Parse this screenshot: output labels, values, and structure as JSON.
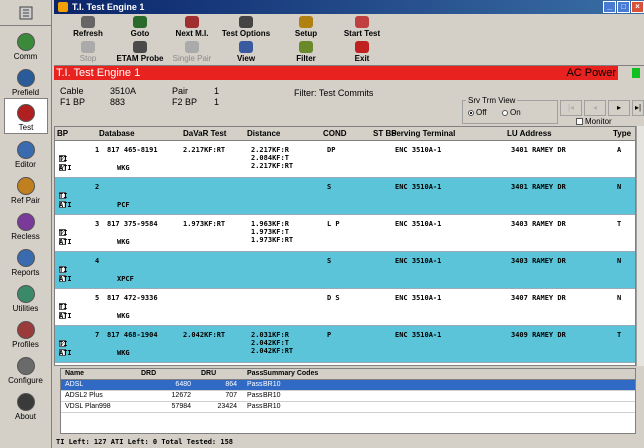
{
  "window": {
    "title": "T.I. Test Engine 1"
  },
  "sidebar": [
    {
      "label": "Comm",
      "icon": "comm-icon"
    },
    {
      "label": "Prefield",
      "icon": "prefield-icon"
    },
    {
      "label": "Test",
      "icon": "test-icon"
    },
    {
      "label": "Editor",
      "icon": "editor-icon"
    },
    {
      "label": "Ref Pair",
      "icon": "ref-pair-icon"
    },
    {
      "label": "Recless",
      "icon": "recless-icon"
    },
    {
      "label": "Reports",
      "icon": "reports-icon"
    },
    {
      "label": "Utilities",
      "icon": "utilities-icon"
    },
    {
      "label": "Profiles",
      "icon": "profiles-icon"
    },
    {
      "label": "Configure",
      "icon": "configure-icon"
    },
    {
      "label": "About",
      "icon": "about-icon"
    }
  ],
  "toolbar": {
    "row1": [
      "Refresh",
      "Goto",
      "Next M.I.",
      "Test Options",
      "Setup",
      "Start Test"
    ],
    "row2": [
      "Stop",
      "ETAM Probe",
      "Single Pair",
      "View",
      "Filter",
      "Exit"
    ]
  },
  "status_bar": {
    "title": "T.I. Test Engine 1",
    "power": "AC Power"
  },
  "info": {
    "cable_label": "Cable",
    "cable_value": "3510A",
    "pair_label": "Pair",
    "pair_value": "1",
    "f1bp_label": "F1 BP",
    "f1bp_value": "883",
    "f2bp_label": "F2 BP",
    "f2bp_value": "1",
    "filter": "Filter: Test Commits",
    "srv_title": "Srv Trm View",
    "off": "Off",
    "on": "On",
    "monitor": "Monitor"
  },
  "grid": {
    "headers": [
      "BP",
      "Database",
      "DaVaR Test",
      "Distance",
      "COND",
      "ST BP",
      "Serving Terminal",
      "LU Address",
      "Type"
    ],
    "rows": [
      {
        "num": "1",
        "db": "817 465-8191",
        "davar": "2.217KF:RT",
        "dist": [
          "2.217KF:R",
          "2.084KF:T",
          "2.217KF:RT"
        ],
        "cond": "DP",
        "term": "ENC 3510A-1",
        "addr": "3401 RAMEY DR",
        "type": "A",
        "ti": true,
        "ati": true,
        "sub": "WKG",
        "color": "w"
      },
      {
        "num": "2",
        "db": "",
        "davar": "",
        "dist": [],
        "cond": "S",
        "term": "ENC 3510A-1",
        "addr": "3401 RAMEY DR",
        "type": "N",
        "ti": false,
        "ati": false,
        "sub": "PCF",
        "color": "c"
      },
      {
        "num": "3",
        "db": "817 375-9584",
        "davar": "1.973KF:RT",
        "dist": [
          "1.963KF:R",
          "1.973KF:T",
          "1.973KF:RT"
        ],
        "cond": "L P",
        "term": "ENC 3510A-1",
        "addr": "3403 RAMEY DR",
        "type": "T",
        "ti": true,
        "ati": false,
        "sub": "WKG",
        "color": "w"
      },
      {
        "num": "4",
        "db": "",
        "davar": "",
        "dist": [],
        "cond": "S",
        "term": "ENC 3510A-1",
        "addr": "3403 RAMEY DR",
        "type": "N",
        "ti": false,
        "ati": false,
        "sub": "XPCF",
        "color": "c"
      },
      {
        "num": "5",
        "db": "817 472-9336",
        "davar": "",
        "dist": [],
        "cond": "D S",
        "term": "ENC 3510A-1",
        "addr": "3407 RAMEY DR",
        "type": "N",
        "ti": false,
        "ati": false,
        "sub": "WKG",
        "color": "w"
      },
      {
        "num": "7",
        "db": "817 468-1904",
        "davar": "2.042KF:RT",
        "dist": [
          "2.031KF:R",
          "2.042KF:T",
          "2.042KF:RT"
        ],
        "cond": "P",
        "term": "ENC 3510A-1",
        "addr": "3409 RAMEY DR",
        "type": "T",
        "ti": true,
        "ati": false,
        "sub": "WKG",
        "color": "c"
      }
    ],
    "ti_label": "TI",
    "ati_label": "ATI"
  },
  "lower": {
    "headers": [
      "Name",
      "DRD",
      "DRU",
      "Pass",
      "Summary Codes"
    ],
    "rows": [
      {
        "name": "ADSL",
        "drd": "6480",
        "dru": "864",
        "pass": "Pass",
        "codes": "BR10"
      },
      {
        "name": "ADSL2 Plus",
        "drd": "12672",
        "dru": "707",
        "pass": "Pass",
        "codes": "BR10"
      },
      {
        "name": "VDSL Plan998",
        "drd": "57984",
        "dru": "23424",
        "pass": "Pass",
        "codes": "BR10"
      }
    ]
  },
  "footer": "TI Left: 127  ATI Left: 0  Total Tested: 158"
}
